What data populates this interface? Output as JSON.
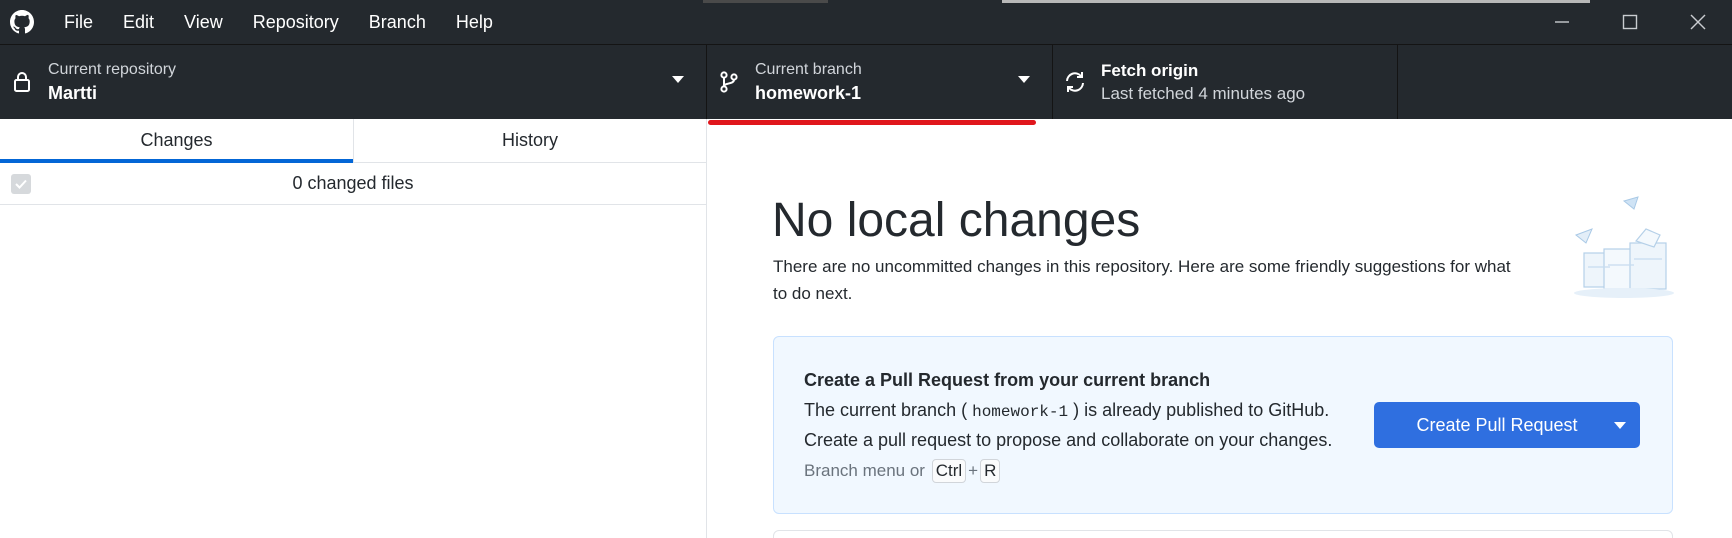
{
  "menu": {
    "items": [
      "File",
      "Edit",
      "View",
      "Repository",
      "Branch",
      "Help"
    ]
  },
  "toolbar": {
    "repository": {
      "label": "Current repository",
      "value": "Martti"
    },
    "branch": {
      "label": "Current branch",
      "value": "homework-1"
    },
    "fetch": {
      "title": "Fetch origin",
      "subtitle": "Last fetched 4 minutes ago"
    }
  },
  "sidebar": {
    "tabs": [
      "Changes",
      "History"
    ],
    "active_tab": "Changes",
    "changed_files": "0 changed files"
  },
  "main": {
    "headline": "No local changes",
    "description": "There are no uncommitted changes in this repository. Here are some friendly suggestions for what to do next."
  },
  "pull_request_card": {
    "title": "Create a Pull Request from your current branch",
    "desc_prefix": "The current branch (",
    "branch_name": "homework-1",
    "desc_suffix": ") is already published to GitHub.",
    "desc_line2": "Create a pull request to propose and collaborate on your changes.",
    "hint_prefix": "Branch menu or",
    "shortcut_key1": "Ctrl",
    "shortcut_plus": "+",
    "shortcut_key2": "R",
    "button_label": "Create Pull Request"
  },
  "colors": {
    "titlebar_bg": "#24292e",
    "accent_blue": "#0366d6",
    "button_blue": "#2f6fe0",
    "highlight_red": "#e0161c",
    "card_bg": "#f1f8ff"
  },
  "icons": [
    "github-logo-icon",
    "minimize-icon",
    "maximize-icon",
    "close-icon",
    "lock-icon",
    "branch-icon",
    "sync-icon",
    "checkbox-icon",
    "chevron-down-icon"
  ]
}
